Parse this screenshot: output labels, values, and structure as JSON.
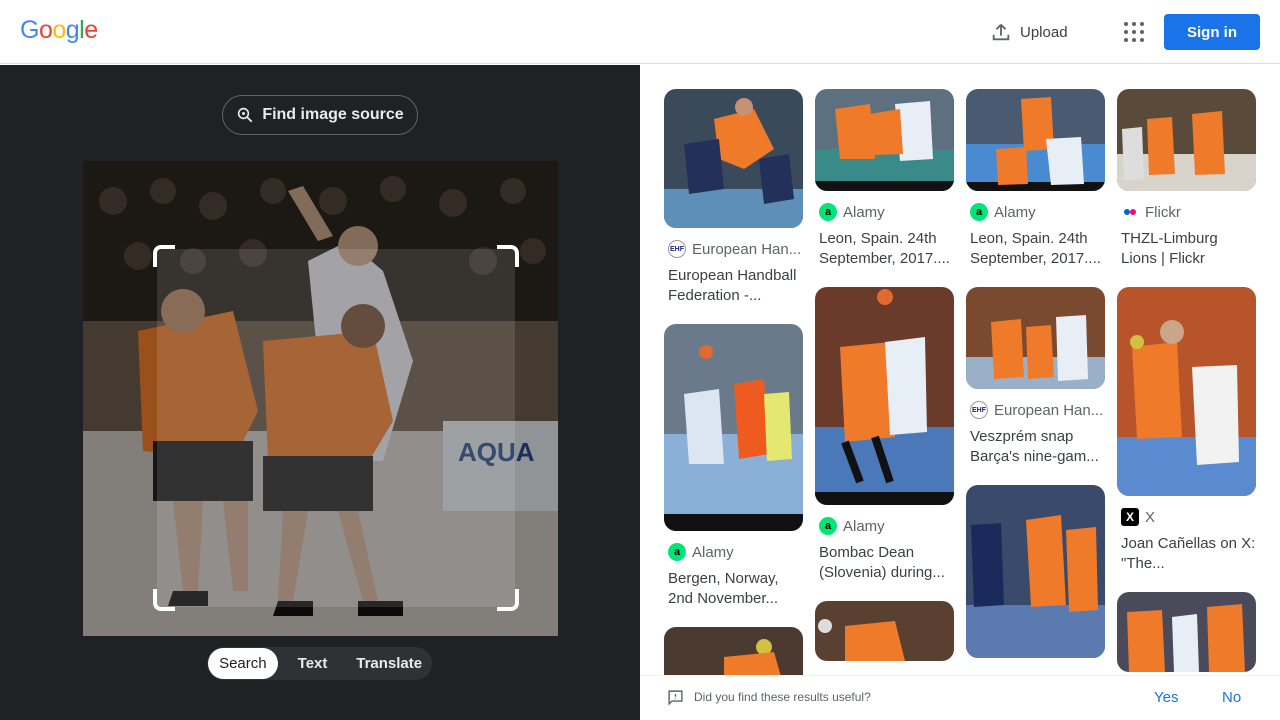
{
  "header": {
    "logo": [
      "G",
      "o",
      "o",
      "g",
      "l",
      "e"
    ],
    "upload_label": "Upload",
    "signin_label": "Sign in"
  },
  "lens": {
    "find_source_label": "Find image source",
    "modes": [
      {
        "label": "Search",
        "active": true
      },
      {
        "label": "Text",
        "active": false
      },
      {
        "label": "Translate",
        "active": false
      }
    ]
  },
  "results": [
    {
      "source": "European Han...",
      "icon": "ehf-icon",
      "title": "European Handball Federation -..."
    },
    {
      "source": "Alamy",
      "icon": "alamy-icon",
      "title": "Leon, Spain. 24th September, 2017...."
    },
    {
      "source": "Alamy",
      "icon": "alamy-icon",
      "title": "Leon, Spain. 24th September, 2017...."
    },
    {
      "source": "Flickr",
      "icon": "flickr-icon",
      "title": "THZL-Limburg Lions | Flickr"
    },
    {
      "source": "Alamy",
      "icon": "alamy-icon",
      "title": "Bergen, Norway, 2nd November..."
    },
    {
      "source": "Alamy",
      "icon": "alamy-icon",
      "title": "Bombac Dean (Slovenia) during..."
    },
    {
      "source": "European Han...",
      "icon": "ehf-icon",
      "title": "Veszprém snap Barça's nine-gam..."
    },
    {
      "source": "X",
      "icon": "x-icon",
      "title": "Joan Cañellas on X: \"The..."
    }
  ],
  "feedback": {
    "question": "Did you find these results useful?",
    "yes_label": "Yes",
    "no_label": "No"
  },
  "colors": {
    "accent": "#1a73e8",
    "dark_pane": "#202124",
    "alamy": "#00e676",
    "handball_orange": "#ee7a2a"
  }
}
